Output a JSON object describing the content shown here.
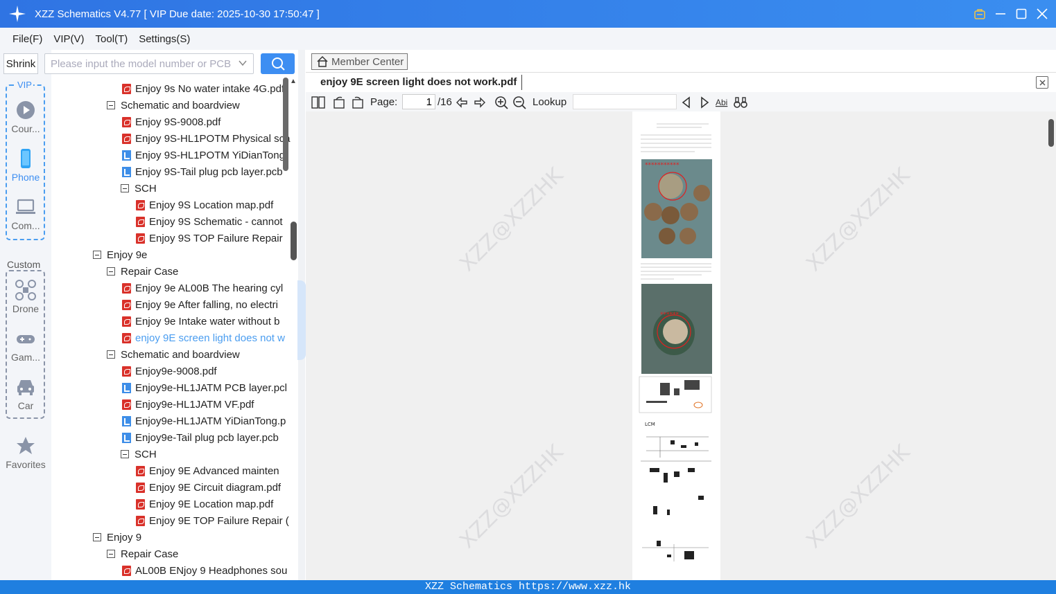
{
  "window": {
    "title": "XZZ Schematics V4.77 [ VIP Due date: 2025-10-30 17:50:47 ]"
  },
  "menu": {
    "items": [
      "File(F)",
      "VIP(V)",
      "Tool(T)",
      "Settings(S)"
    ]
  },
  "search": {
    "shrink_label": "Shrink",
    "placeholder": "Please input the model number or PCB"
  },
  "nav": {
    "vip_label": "VIP",
    "vip_items": [
      {
        "label": "Cour...",
        "icon": "course-icon"
      },
      {
        "label": "Phone",
        "icon": "phone-icon"
      },
      {
        "label": "Com...",
        "icon": "computer-icon"
      }
    ],
    "custom_label": "Custom",
    "custom_items": [
      {
        "label": "Drone",
        "icon": "drone-icon"
      },
      {
        "label": "Gam...",
        "icon": "gamepad-icon"
      },
      {
        "label": "Car",
        "icon": "car-icon"
      }
    ],
    "favorites_label": "Favorites"
  },
  "tree": [
    {
      "label": "Enjoy 9s No water intake 4G.pdf",
      "kind": "pdf",
      "depth": 2
    },
    {
      "label": "Schematic and boardview",
      "kind": "folder",
      "depth": 1
    },
    {
      "label": "Enjoy 9S-9008.pdf",
      "kind": "pdf",
      "depth": 2
    },
    {
      "label": "Enjoy 9S-HL1POTM Physical sca",
      "kind": "pdf",
      "depth": 2
    },
    {
      "label": "Enjoy 9S-HL1POTM YiDianTong",
      "kind": "pcb",
      "depth": 2
    },
    {
      "label": "Enjoy 9S-Tail plug pcb layer.pcb",
      "kind": "pcb",
      "depth": 2
    },
    {
      "label": "SCH",
      "kind": "folder",
      "depth": 2
    },
    {
      "label": "Enjoy 9S Location map.pdf",
      "kind": "pdf",
      "depth": 3
    },
    {
      "label": "Enjoy 9S Schematic - cannot",
      "kind": "pdf",
      "depth": 3
    },
    {
      "label": "Enjoy 9S TOP  Failure Repair",
      "kind": "pdf",
      "depth": 3
    },
    {
      "label": "Enjoy 9e",
      "kind": "folder",
      "depth": 0
    },
    {
      "label": "Repair Case",
      "kind": "folder",
      "depth": 1
    },
    {
      "label": "Enjoy 9e AL00B The hearing cyl",
      "kind": "pdf",
      "depth": 2
    },
    {
      "label": "Enjoy 9e After falling, no electri",
      "kind": "pdf",
      "depth": 2
    },
    {
      "label": "Enjoy 9e Intake water without b",
      "kind": "pdf",
      "depth": 2
    },
    {
      "label": "enjoy 9E screen light does not w",
      "kind": "pdf",
      "depth": 2,
      "selected": true
    },
    {
      "label": "Schematic and boardview",
      "kind": "folder",
      "depth": 1
    },
    {
      "label": "Enjoy9e-9008.pdf",
      "kind": "pdf",
      "depth": 2
    },
    {
      "label": "Enjoy9e-HL1JATM PCB layer.pcl",
      "kind": "pcb",
      "depth": 2
    },
    {
      "label": "Enjoy9e-HL1JATM VF.pdf",
      "kind": "pdf",
      "depth": 2
    },
    {
      "label": "Enjoy9e-HL1JATM YiDianTong.p",
      "kind": "pcb",
      "depth": 2
    },
    {
      "label": "Enjoy9e-Tail plug pcb layer.pcb",
      "kind": "pcb",
      "depth": 2
    },
    {
      "label": "SCH",
      "kind": "folder",
      "depth": 2
    },
    {
      "label": "Enjoy 9E Advanced mainten",
      "kind": "pdf",
      "depth": 3
    },
    {
      "label": "Enjoy 9E Circuit diagram.pdf",
      "kind": "pdf",
      "depth": 3
    },
    {
      "label": "Enjoy 9E Location map.pdf",
      "kind": "pdf",
      "depth": 3
    },
    {
      "label": "Enjoy 9E TOP Failure Repair (",
      "kind": "pdf",
      "depth": 3
    },
    {
      "label": "Enjoy 9",
      "kind": "folder",
      "depth": 0
    },
    {
      "label": "Repair Case",
      "kind": "folder",
      "depth": 1
    },
    {
      "label": "AL00B ENjoy 9 Headphones sou",
      "kind": "pdf",
      "depth": 2
    }
  ],
  "viewer": {
    "member_center": "Member Center",
    "tab_title": "enjoy 9E screen light does not work.pdf",
    "page_label": "Page:",
    "page_current": "1",
    "page_total": "/16",
    "lookup_label": "Lookup",
    "watermark": "XZZ@XZZHK"
  },
  "status": {
    "text": "XZZ Schematics https://www.xzz.hk"
  },
  "colors": {
    "titlebar": "#3a8ef0",
    "accent": "#3d8ef2",
    "status": "#1f7fe0",
    "pdf": "#d9312a"
  }
}
